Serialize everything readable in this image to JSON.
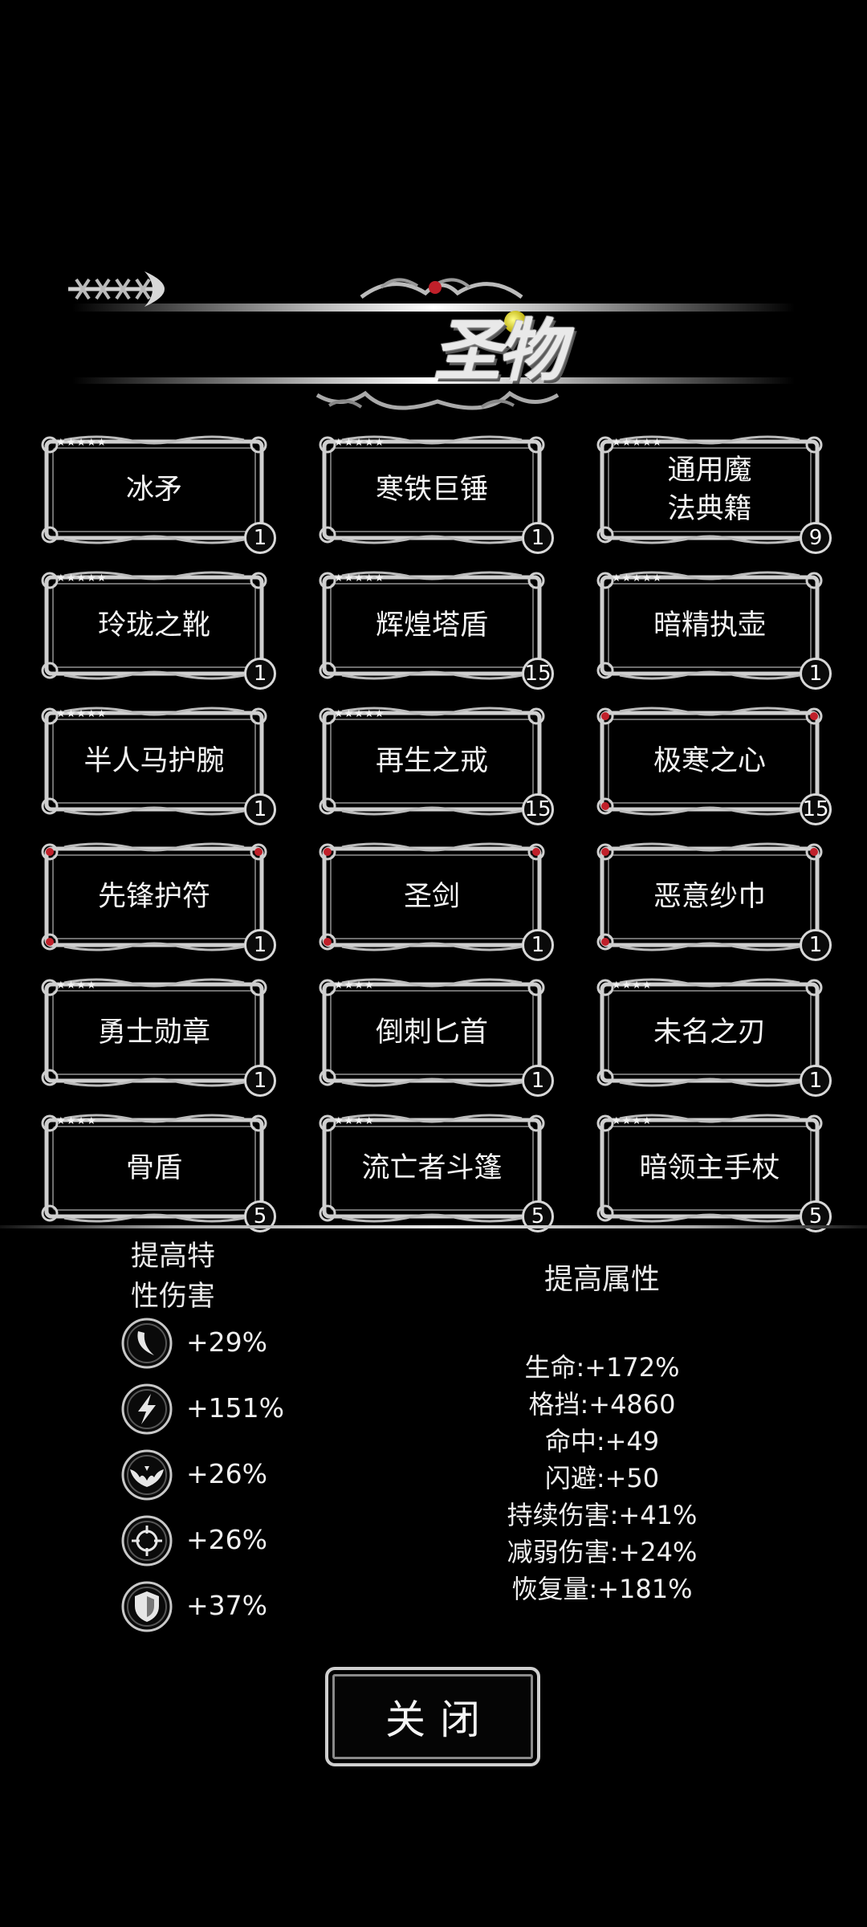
{
  "header": {
    "title": "圣物",
    "back_icon": "ornate-arrow-icon"
  },
  "relics": [
    {
      "name": "冰矛",
      "stars": "★★★★★",
      "count": "1"
    },
    {
      "name": "寒铁巨锤",
      "stars": "★★★★★",
      "count": "1"
    },
    {
      "name": "通用魔法典籍",
      "stars": "★★★★★",
      "count": "9"
    },
    {
      "name": "玲珑之靴",
      "stars": "★★★★★",
      "count": "1"
    },
    {
      "name": "辉煌塔盾",
      "stars": "★★★★★",
      "count": "15"
    },
    {
      "name": "暗精执壶",
      "stars": "★★★★★",
      "count": "1"
    },
    {
      "name": "半人马护腕",
      "stars": "★★★★★",
      "count": "1"
    },
    {
      "name": "再生之戒",
      "stars": "★★★★★",
      "count": "15"
    },
    {
      "name": "极寒之心",
      "stars": "",
      "count": "15"
    },
    {
      "name": "先锋护符",
      "stars": "",
      "count": "1"
    },
    {
      "name": "圣剑",
      "stars": "",
      "count": "1"
    },
    {
      "name": "恶意纱巾",
      "stars": "",
      "count": "1"
    },
    {
      "name": "勇士勋章",
      "stars": "★★★★",
      "count": "1"
    },
    {
      "name": "倒刺匕首",
      "stars": "★★★★",
      "count": "1"
    },
    {
      "name": "未名之刃",
      "stars": "★★★★",
      "count": "1"
    },
    {
      "name": "骨盾",
      "stars": "★★★★",
      "count": "5"
    },
    {
      "name": "流亡者斗篷",
      "stars": "★★★★",
      "count": "5"
    },
    {
      "name": "暗领主手杖",
      "stars": "★★★★",
      "count": "5"
    }
  ],
  "trait_damage": {
    "heading": "提高特性伤害",
    "items": [
      {
        "icon": "crescent-blade-icon",
        "value": "+29%"
      },
      {
        "icon": "lightning-icon",
        "value": "+151%"
      },
      {
        "icon": "bat-wing-icon",
        "value": "+26%"
      },
      {
        "icon": "crosshair-icon",
        "value": "+26%"
      },
      {
        "icon": "shield-icon",
        "value": "+37%"
      }
    ]
  },
  "attributes": {
    "heading": "提高属性",
    "items": [
      "生命:+172%",
      "格挡:+4860",
      "命中:+49",
      "闪避:+50",
      "持续伤害:+41%",
      "减弱伤害:+24%",
      "恢复量:+181%"
    ]
  },
  "close_button": {
    "label": "关闭"
  },
  "colors": {
    "background": "#000000",
    "frame_silver": "#c8c8c8",
    "gem_red": "#c0202a",
    "title_gem": "#d8d000"
  }
}
